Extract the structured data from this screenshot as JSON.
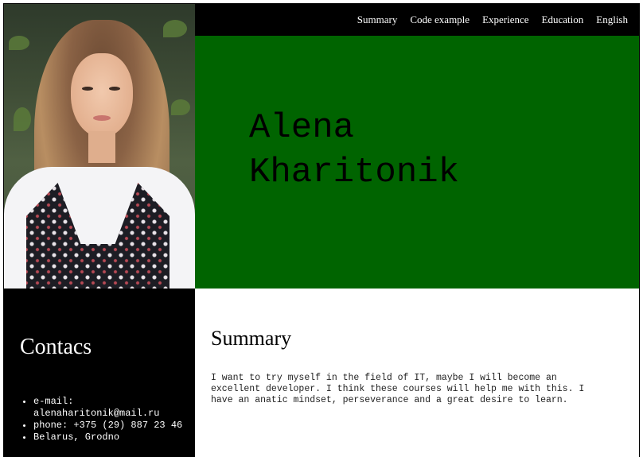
{
  "nav": {
    "items": [
      "Summary",
      "Code example",
      "Experience",
      "Education",
      "English"
    ]
  },
  "hero": {
    "first_name": "Alena",
    "last_name": "Kharitonik",
    "background_color": "#006400"
  },
  "contacts": {
    "title": "Contacs",
    "items": [
      "e-mail: alenaharitonik@mail.ru",
      "phone: +375 (29) 887 23 46",
      "Belarus, Grodno"
    ]
  },
  "summary": {
    "title": "Summary",
    "text": "I want to try myself in the field of IT, maybe I will become an excellent developer. I think these courses will help me with this. I have an anatic mindset, perseverance and a great desire to learn."
  },
  "colors": {
    "accent": "#006400",
    "nav_bg": "#000000",
    "contacts_bg": "#000000"
  }
}
